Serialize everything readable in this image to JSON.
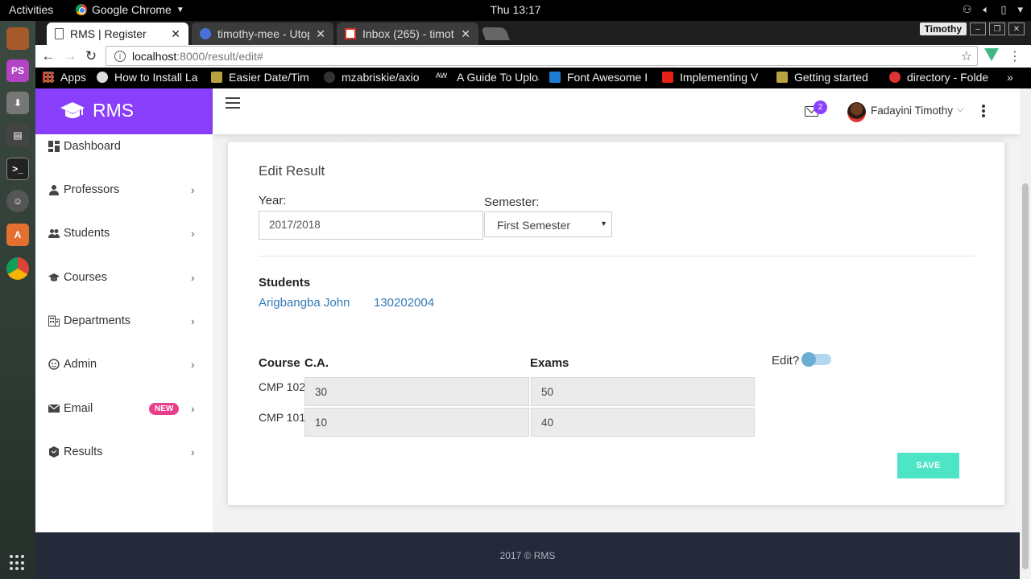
{
  "os": {
    "activities": "Activities",
    "app_menu": "Google Chrome",
    "clock": "Thu 13:17"
  },
  "browser": {
    "tabs": [
      {
        "title": "RMS | Register",
        "active": true
      },
      {
        "title": "timothy-mee - Utop",
        "active": false
      },
      {
        "title": "Inbox (265) - timoth",
        "active": false
      }
    ],
    "profile": "Timothy",
    "url_host": "localhost",
    "url_path": ":8000/result/edit#",
    "bookmarks": [
      "Apps",
      "How to Install La",
      "Easier Date/Tim",
      "mzabriskie/axio",
      "A Guide To Uploa",
      "Font Awesome I",
      "Implementing V",
      "Getting started",
      "directory - Folde"
    ],
    "more_bookmarks": "»"
  },
  "app": {
    "brand": "RMS",
    "sidebar": [
      {
        "label": "Dashboard",
        "icon": "dashboard-icon",
        "chevron": false
      },
      {
        "label": "Professors",
        "icon": "person-icon",
        "chevron": true
      },
      {
        "label": "Students",
        "icon": "people-icon",
        "chevron": true
      },
      {
        "label": "Courses",
        "icon": "graduation-cap-icon",
        "chevron": true
      },
      {
        "label": "Departments",
        "icon": "building-icon",
        "chevron": true
      },
      {
        "label": "Admin",
        "icon": "face-icon",
        "chevron": true
      },
      {
        "label": "Email",
        "icon": "email-icon",
        "chevron": true,
        "badge": "NEW"
      },
      {
        "label": "Results",
        "icon": "results-icon",
        "chevron": true
      }
    ],
    "header": {
      "mail_count": "2",
      "user_name": "Fadayini Timothy"
    },
    "form": {
      "title": "Edit Result",
      "year_label": "Year:",
      "year_value": "2017/2018",
      "semester_label": "Semester:",
      "semester_value": "First Semester",
      "students_heading": "Students",
      "student_name": "Arigbangba John",
      "student_id": "130202004",
      "col_course": "Course",
      "col_ca": "C.A.",
      "col_exams": "Exams",
      "rows": [
        {
          "course": "CMP 102",
          "ca": "30",
          "exams": "50"
        },
        {
          "course": "CMP 101",
          "ca": "10",
          "exams": "40"
        }
      ],
      "edit_label": "Edit?",
      "save_label": "SAVE"
    },
    "footer": "2017 © RMS"
  },
  "colors": {
    "brand_purple": "#8a3ffc",
    "link_blue": "#337ab7",
    "save_teal": "#4ee5c6",
    "footer_navy": "#252a3a",
    "badge_pink": "#e83e8c"
  }
}
